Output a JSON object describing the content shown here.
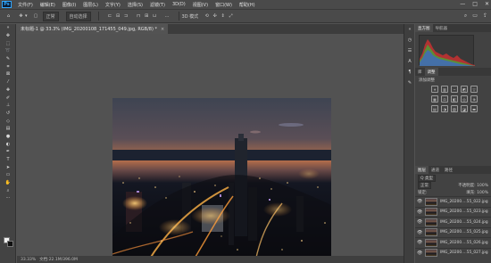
{
  "app": {
    "logo": "Ps"
  },
  "menu": [
    "文件(F)",
    "编辑(E)",
    "图像(I)",
    "图层(L)",
    "文字(Y)",
    "选择(S)",
    "滤镜(T)",
    "3D(D)",
    "视图(V)",
    "窗口(W)",
    "帮助(H)"
  ],
  "window_controls": [
    "—",
    "□",
    "✕"
  ],
  "options": {
    "mode_label": "模式",
    "mode_value": "正常",
    "extra_label": "自动选择",
    "right_label": "3D 模式"
  },
  "document_tab": {
    "title": "未标题-1 @ 33.3% (IMG_20200108_171455_049.jpg, RGB/8) *",
    "close": "×"
  },
  "status": {
    "zoom": "33.33%",
    "doc_info": "文档:22.1M/396.0M"
  },
  "panels": {
    "histogram_tabs": [
      "直方图",
      "导航器"
    ],
    "adjust_tabs": [
      "库",
      "调整"
    ],
    "adjust_title": "添加调整",
    "layers_tabs": [
      "图层",
      "通道",
      "路径"
    ],
    "filter_label": "Q 类型",
    "blend_mode": "正常",
    "opacity_label": "不透明度: 100%",
    "lock_label": "锁定:",
    "fill_label": "填充: 100%"
  },
  "layers": [
    {
      "name": "IMG_20200….55_022.jpg",
      "selected": false
    },
    {
      "name": "IMG_20200….55_023.jpg",
      "selected": false
    },
    {
      "name": "IMG_20200….55_024.jpg",
      "selected": false
    },
    {
      "name": "IMG_20200….55_025.jpg",
      "selected": false
    },
    {
      "name": "IMG_20200….55_026.jpg",
      "selected": false
    },
    {
      "name": "IMG_20200….55_027.jpg",
      "selected": false
    }
  ],
  "colors": {
    "accent": "#31a8ff",
    "histogram_red": "#d93030",
    "histogram_green": "#37b737",
    "histogram_blue": "#3a62d8"
  }
}
